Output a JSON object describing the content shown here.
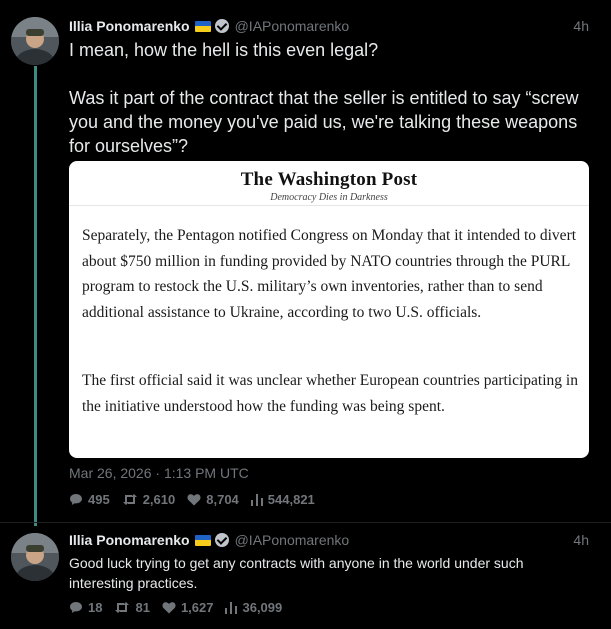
{
  "tweets": [
    {
      "author_name": "Illia Ponomarenko",
      "handle": "@IAPonomarenko",
      "time": "4h",
      "text_line1": "I mean, how the hell is this even legal?",
      "text_line2": "Was it part of the contract that the seller is entitled to say “screw you and the money you've paid us, we're talking these weapons for ourselves”?",
      "card": {
        "logo": "The Washington Post",
        "tagline": "Democracy Dies in Darkness",
        "paragraph1": "Separately, the Pentagon notified Congress on Monday that it intended to divert about $750 million in funding provided by NATO countries through the PURL program to restock the U.S. military’s own inventories, rather than to send additional assistance to Ukraine, according to two U.S. officials.",
        "paragraph2": "The first official said it was unclear whether European countries participating in the initiative understood how the funding was being spent."
      },
      "date": "Mar 26, 2026 · 1:13 PM UTC",
      "stats": {
        "replies": "495",
        "retweets": "2,610",
        "likes": "8,704",
        "views": "544,821"
      }
    },
    {
      "author_name": "Illia Ponomarenko",
      "handle": "@IAPonomarenko",
      "time": "4h",
      "text": "Good luck trying to get any contracts with anyone in the world under such interesting practices.",
      "stats": {
        "replies": "18",
        "retweets": "81",
        "likes": "1,627",
        "views": "36,099"
      }
    }
  ],
  "icons": [
    "reply-icon",
    "retweet-icon",
    "like-icon",
    "views-icon",
    "verified-icon",
    "ukraine-flag-icon"
  ],
  "colors": {
    "background": "#000000",
    "text": "#e7e9ea",
    "muted": "#71767b",
    "thread_line": "#3f8a83"
  }
}
